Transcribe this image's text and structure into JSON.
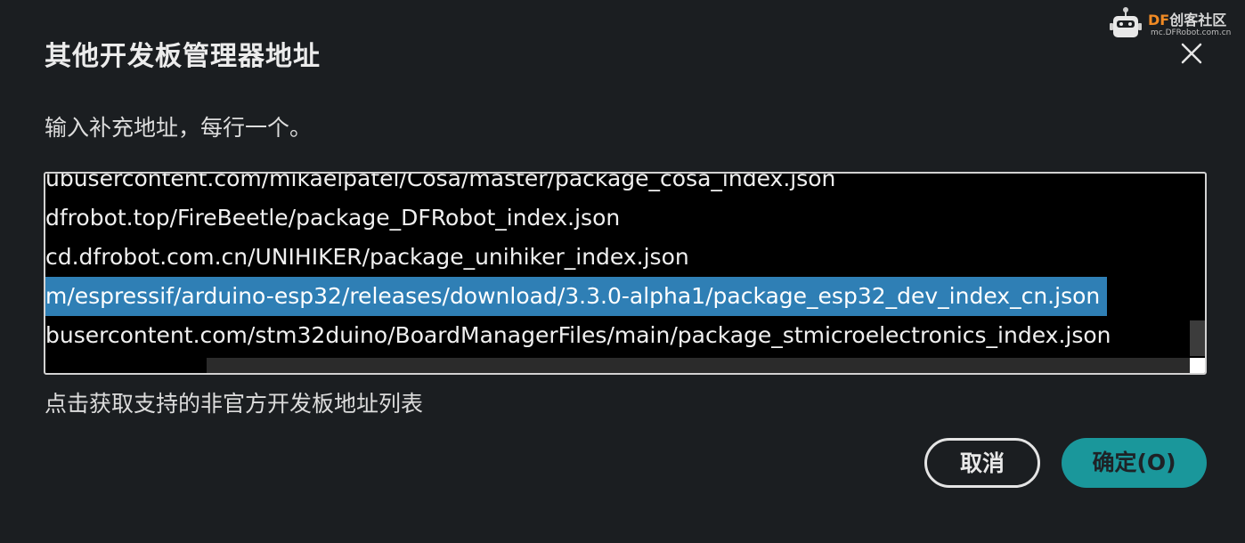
{
  "dialog": {
    "title": "其他开发板管理器地址",
    "instruction": "输入补充地址，每行一个。",
    "urls": [
      "ubusercontent.com/mikaelpatel/Cosa/master/package_cosa_index.json",
      "dfrobot.top/FireBeetle/package_DFRobot_index.json",
      "cd.dfrobot.com.cn/UNIHIKER/package_unihiker_index.json",
      "m/espressif/arduino-esp32/releases/download/3.3.0-alpha1/package_esp32_dev_index_cn.json",
      "busercontent.com/stm32duino/BoardManagerFiles/main/package_stmicroelectronics_index.json"
    ],
    "selected_line_index": 3,
    "unofficial_list_link": "点击获取支持的非官方开发板地址列表",
    "cancel_label": "取消",
    "ok_label": "确定(O)",
    "close_icon": "close-icon"
  },
  "watermark": {
    "brand_prefix": "DF",
    "brand_suffix": "创客社区",
    "url": "mc.DFRobot.com.cn"
  },
  "colors": {
    "background": "#1b1e21",
    "selection": "#2f7fb5",
    "primary_button": "#1a979b"
  }
}
